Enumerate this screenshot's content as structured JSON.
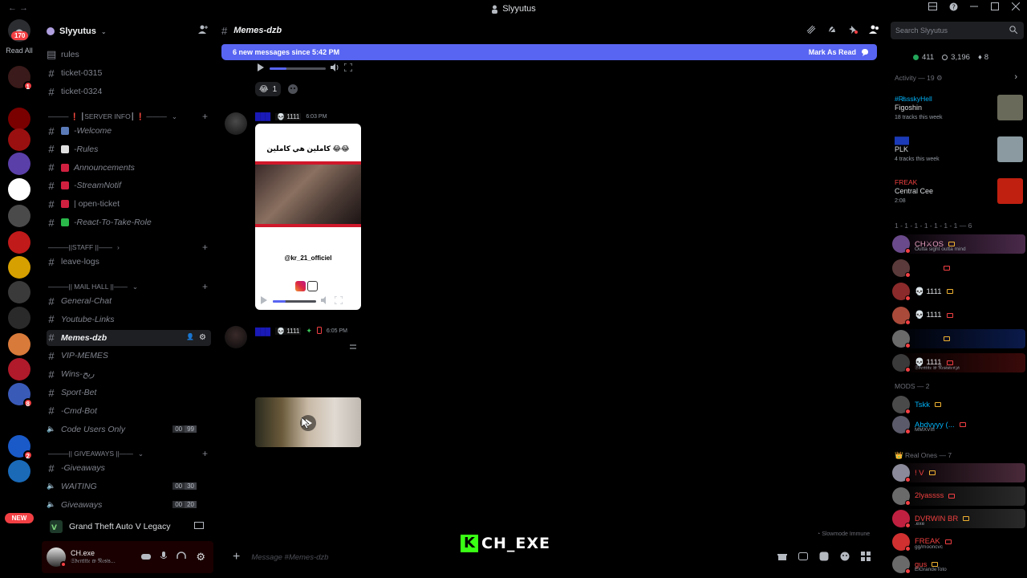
{
  "window": {
    "title": "Slyyutus",
    "controls": [
      "inbox",
      "help",
      "minimize",
      "maximize",
      "close"
    ]
  },
  "rail": {
    "top_badge": "170",
    "read_all": "Read All",
    "new_pill": "NEW",
    "servers": [
      {
        "color": "#3a1a1a",
        "badge": "1"
      },
      {
        "color": "#7a0000",
        "badge": ""
      },
      {
        "color": "#9a1010",
        "badge": ""
      },
      {
        "color": "#5a3fa8",
        "badge": ""
      },
      {
        "color": "#ffffff",
        "badge": ""
      },
      {
        "color": "#4a4a4a",
        "badge": ""
      },
      {
        "color": "#c01a1a",
        "badge": ""
      },
      {
        "color": "#d6a000",
        "badge": ""
      },
      {
        "color": "#3a3a3a",
        "badge": ""
      },
      {
        "color": "#2a2a2a",
        "badge": ""
      },
      {
        "color": "#d87a3a",
        "badge": ""
      },
      {
        "color": "#b01a2a",
        "badge": ""
      },
      {
        "color": "#3a5ab8",
        "badge": "8"
      },
      {
        "color": "#000000",
        "badge": ""
      },
      {
        "color": "#1a5ac8",
        "badge": "2"
      },
      {
        "color": "#1a6ab8",
        "badge": ""
      }
    ]
  },
  "sidebar": {
    "server_name": "Slyyutus",
    "channels_top": [
      {
        "label": "rules",
        "italic": false
      },
      {
        "label": "ticket-0315",
        "italic": false
      },
      {
        "label": "ticket-0324",
        "italic": false
      }
    ],
    "cat_server_info": "┃SERVER INFO┃",
    "server_info_channels": [
      {
        "label": "-Welcome",
        "emoji_color": "#5a7ab8"
      },
      {
        "label": "-Rules",
        "emoji_color": "#e0e0e0"
      },
      {
        "label": "Announcements",
        "emoji_color": "#d02040"
      },
      {
        "label": "-StreamNotif",
        "emoji_color": "#d02040"
      },
      {
        "label": "| open-ticket",
        "emoji_color": "#d02040",
        "plain": true
      },
      {
        "label": "-React-To-Take-Role",
        "emoji_color": "#2ab84a"
      }
    ],
    "cat_staff": "||STAFF ||",
    "staff_channels": [
      {
        "label": "leave-logs"
      }
    ],
    "cat_mail_hall": "|| MAIL HALL ||",
    "mail_channels": [
      {
        "label": "General-Chat"
      },
      {
        "label": "Youtube-Links"
      },
      {
        "label": "Memes-dzb",
        "active": true
      },
      {
        "label": "VIP-MEMES"
      },
      {
        "label": "Wins-ربح"
      },
      {
        "label": "Sport-Bet"
      },
      {
        "label": "-Cmd-Bot"
      },
      {
        "label": "Code Users Only",
        "voice": true,
        "count_a": "00",
        "count_b": "99"
      }
    ],
    "cat_giveaways": "|| GIVEAWAYS ||",
    "giveaway_channels": [
      {
        "label": "-Giveaways",
        "voice": false
      },
      {
        "label": "WAITING",
        "voice": true,
        "count_a": "00",
        "count_b": "30"
      },
      {
        "label": "Giveaways",
        "voice": true,
        "count_a": "00",
        "count_b": "20"
      }
    ],
    "game_activity": "Grand Theft Auto V Legacy",
    "user": {
      "name": "CH.exe",
      "status": "𝔖𝔡𝔢𝔫𝔱𝔦𝔱𝔢 𝔴 𝔑𝔢𝔰𝔦𝔰..."
    }
  },
  "chat": {
    "channel_name": "Memes-dzb",
    "banner_text": "6 new messages since 5:42 PM",
    "mark_as_read": "Mark As Read",
    "reaction_count": "1",
    "messages": [
      {
        "author": "███",
        "tag": "💀 1111",
        "time": "6:03 PM",
        "caption": "كاملين هي كاملين 😂😂",
        "handle": "@kr_21_officiel"
      },
      {
        "author": "███",
        "tag": "💀 1111",
        "time": "6:05 PM"
      }
    ],
    "composer_placeholder": "Message #Memes-dzb",
    "slowmode": "Slowmode Immune"
  },
  "watermark": {
    "k": "K",
    "text": "CH_EXE"
  },
  "right": {
    "search_placeholder": "Search Slyyutus",
    "stats": {
      "online": "411",
      "members": "3,196",
      "boosts": "8"
    },
    "activity_title": "Activity — 19",
    "activities": [
      {
        "user": "#R̸ssskyHell",
        "user_color": "#00b0f4",
        "title": "Figoshin",
        "meta": "18 tracks this week",
        "thumb": "#6a6a5a"
      },
      {
        "user": "███",
        "user_color": "#1a3ab8",
        "title": "PLK",
        "meta": "4 tracks this week",
        "thumb": "#8a9aa0"
      },
      {
        "user": "FREAK",
        "user_color": "#f04040",
        "title": "Central Cee",
        "meta": "2:08",
        "thumb": "#c02010"
      }
    ],
    "group1_title": "1 - 1 - 1 - 1 - 1 - 1 - 1 — 6",
    "group1": [
      {
        "name": "CH⚔OS",
        "sub": "Outta sight outta mind",
        "color": "#e8a0c0",
        "av": "#6a4a8a",
        "bg": "#4a2a4a"
      },
      {
        "name": "",
        "sub": "",
        "color": "#dbdee1",
        "av": "#5a3a3a",
        "bg": ""
      },
      {
        "name": "💀 1111",
        "sub": "",
        "color": "#dbdee1",
        "av": "#8a2a2a",
        "bg": ""
      },
      {
        "name": "💀 1111",
        "sub": "",
        "color": "#dbdee1",
        "av": "#aa4a3a",
        "bg": ""
      },
      {
        "name": "",
        "sub": "",
        "color": "#dbdee1",
        "av": "#6a6a6a",
        "bg": "#0a1a4a"
      },
      {
        "name": "💀 1111",
        "sub": "𝔖𝔡𝔢𝔫𝔱𝔦𝔱𝔢 𝔴 𝔑𝔢𝔰𝔦𝔰𝔱𝔢𝔫𝔷𝔞",
        "color": "#dbdee1",
        "av": "#3a3a3a",
        "bg": "#3a0a0a"
      }
    ],
    "mods_title": "MODS — 2",
    "mods": [
      {
        "name": "Tskk",
        "color": "#00b0f4",
        "av": "#4a4a4a",
        "sub": ""
      },
      {
        "name": "Abdvyyy (...",
        "color": "#00b0f4",
        "av": "#5a5a6a",
        "sub": "MMXVIII"
      }
    ],
    "real_title": "Real Ones — 7",
    "real": [
      {
        "name": "! V",
        "color": "#f04040",
        "av": "#8a8a9a",
        "sub": "",
        "bg": "#4a2a3a"
      },
      {
        "name": "2lyassss",
        "color": "#f04040",
        "av": "#6a6a6a",
        "sub": "",
        "bg": "#2a2a2a"
      },
      {
        "name": "DVRWIN BR",
        "color": "#f04040",
        "av": "#c02040",
        "sub": ".exe",
        "bg": "#2a2a2a"
      },
      {
        "name": "FREAK",
        "color": "#f04040",
        "av": "#d03030",
        "sub": "gg/mooncvc",
        "bg": ""
      },
      {
        "name": "gus",
        "color": "#f04040",
        "av": "#6a6a6a",
        "sub": "ElGrandeToto",
        "bg": ""
      }
    ]
  }
}
